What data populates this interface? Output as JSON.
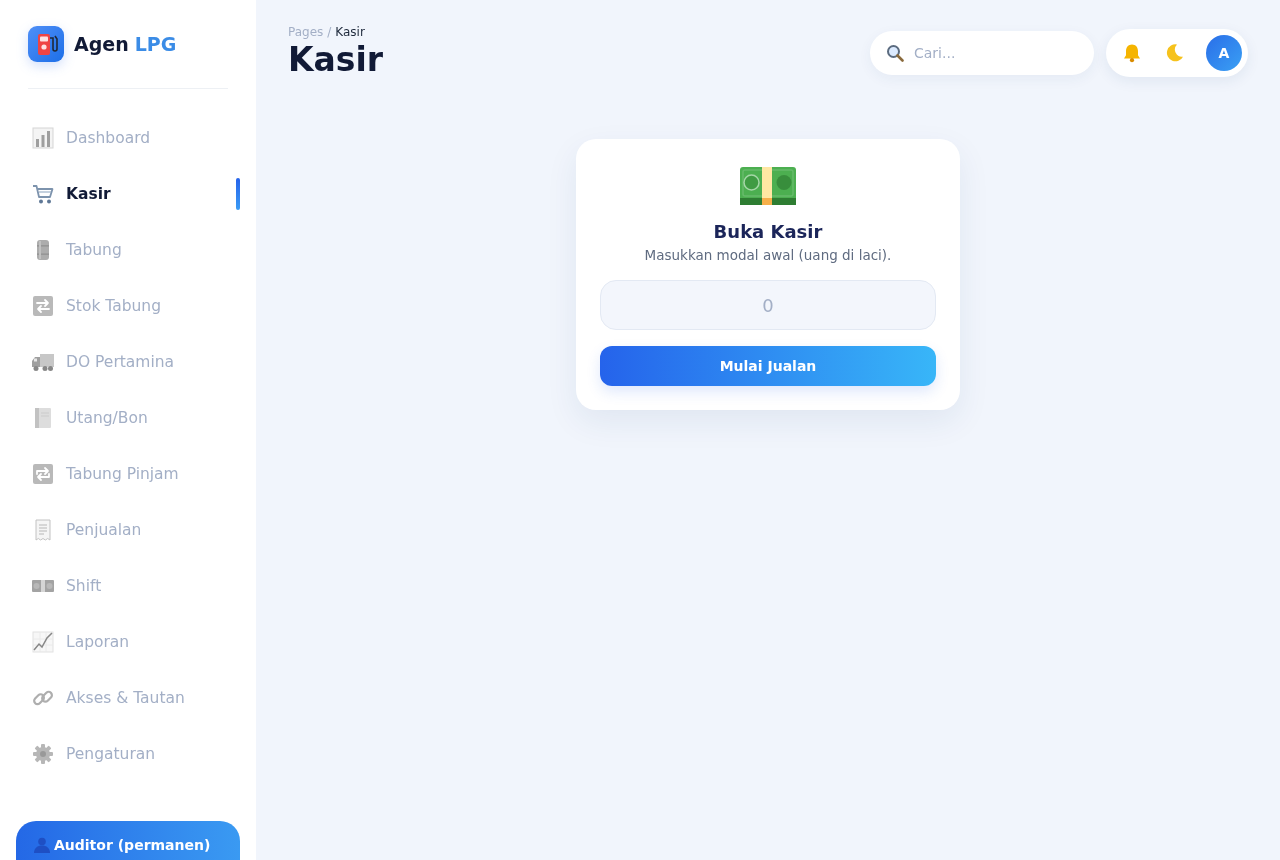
{
  "sidebar": {
    "brand": {
      "name": "Agen",
      "accent": "LPG"
    },
    "items": [
      {
        "label": "Dashboard",
        "selected": false
      },
      {
        "label": "Kasir",
        "selected": true
      },
      {
        "label": "Tabung",
        "selected": false
      },
      {
        "label": "Stok Tabung",
        "selected": false
      },
      {
        "label": "DO Pertamina",
        "selected": false
      },
      {
        "label": "Utang/Bon",
        "selected": false
      },
      {
        "label": "Tabung Pinjam",
        "selected": false
      },
      {
        "label": "Penjualan",
        "selected": false
      },
      {
        "label": "Shift",
        "selected": false
      },
      {
        "label": "Laporan",
        "selected": false
      },
      {
        "label": "Akses & Tautan",
        "selected": false
      },
      {
        "label": "Pengaturan",
        "selected": false
      }
    ],
    "user_card": {
      "name": "Auditor (permanen)"
    }
  },
  "header": {
    "breadcrumb": {
      "parent": "Pages",
      "separator": "/",
      "current": "Kasir"
    },
    "title": "Kasir",
    "search": {
      "placeholder": "Cari..."
    },
    "avatar": {
      "initial": "A"
    }
  },
  "open_register_card": {
    "title": "Buka Kasir",
    "subtitle": "Masukkan modal awal (uang di laci).",
    "amount_field": {
      "placeholder": "0"
    },
    "button": "Mulai Jualan"
  }
}
